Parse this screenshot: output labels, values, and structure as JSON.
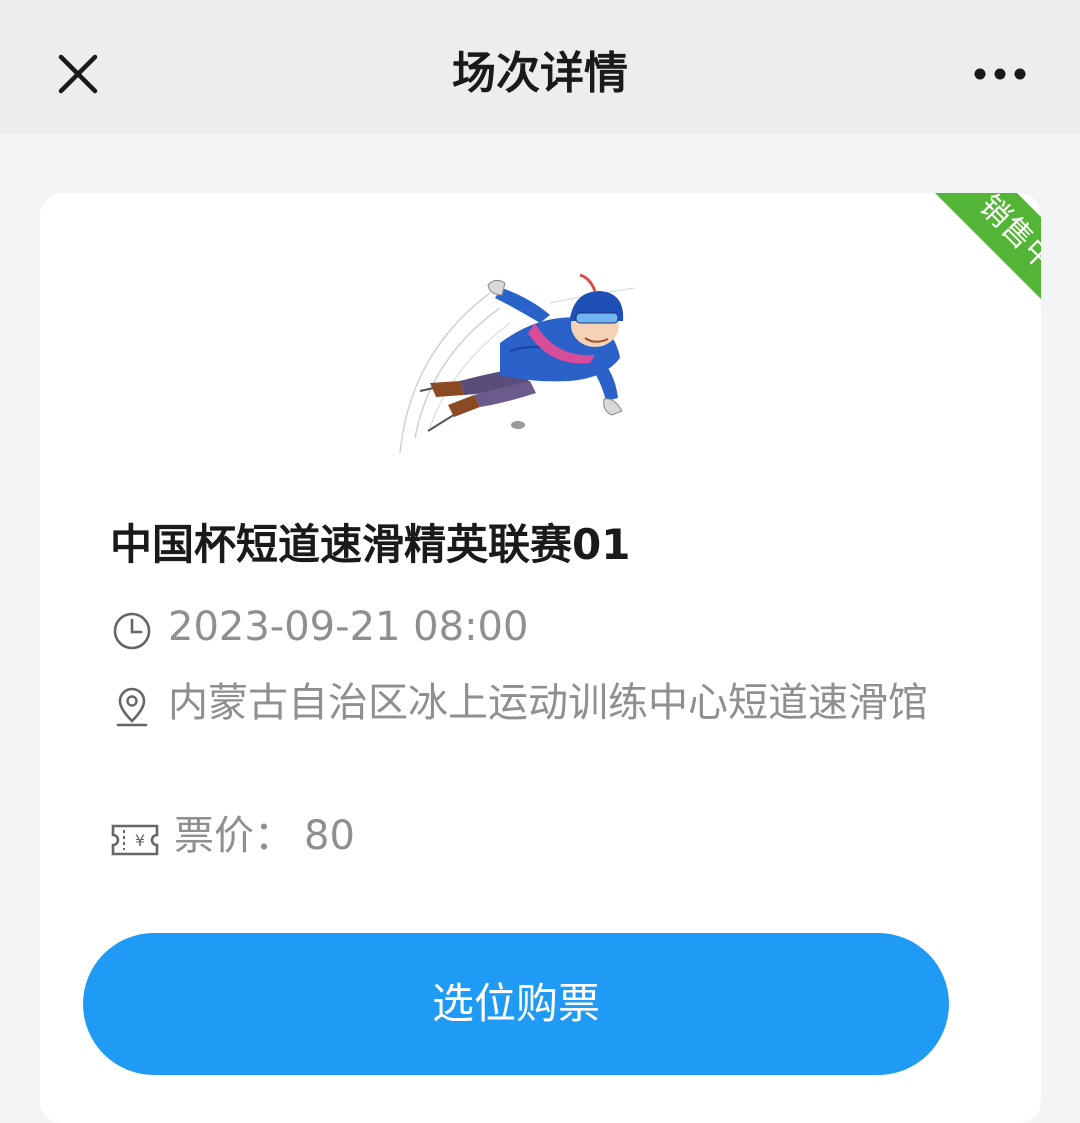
{
  "navbar": {
    "title": "场次详情",
    "close_icon": "close-icon",
    "more_icon": "more-dots-icon"
  },
  "card": {
    "status_badge": "销售中",
    "image_alt": "短道速滑运动员卡通形象",
    "title": "中国杯短道速滑精英联赛01",
    "datetime": "2023-09-21 08:00",
    "location": "内蒙古自治区冰上运动训练中心短道速滑馆",
    "price_label": "票价：",
    "price_value": "80",
    "buy_button": "选位购票"
  },
  "colors": {
    "accent": "#1f9af5",
    "badge": "#53b535",
    "text_primary": "#1a1a1a",
    "text_secondary": "#8f8f8f",
    "page_background": "#f3f4f6",
    "navbar_background": "#ededed"
  }
}
